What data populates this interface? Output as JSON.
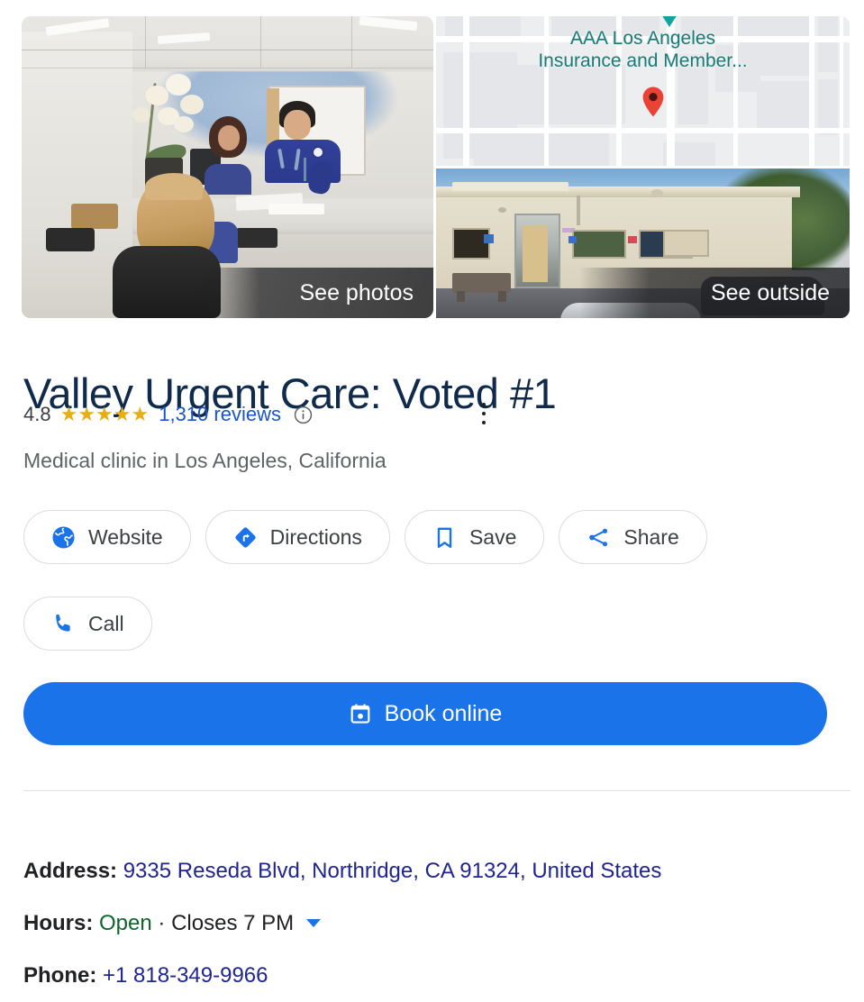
{
  "media": {
    "clinic_photo": {
      "name": "clinic-interior-photo",
      "overlay_label": "See photos"
    },
    "map": {
      "name": "location-map",
      "poi_label_line1": "AAA Los Angeles",
      "poi_label_line2": "Insurance and Member...",
      "pin": "map-pin"
    },
    "street_view": {
      "name": "street-view-photo",
      "overlay_label": "See outside"
    }
  },
  "business": {
    "title": "Valley Urgent Care: Voted #1",
    "rating_value": "4.8",
    "stars": "★★★★★",
    "stars_filled": 5,
    "reviews_label": "1,310 reviews",
    "reviews_count": 1310,
    "info_icon": "info-icon",
    "more_options_icon": "three-dot-menu-icon",
    "subtitle": "Medical clinic in Los Angeles, California"
  },
  "actions": [
    {
      "label": "Website",
      "icon": "globe-icon"
    },
    {
      "label": "Directions",
      "icon": "directions-diamond-icon"
    },
    {
      "label": "Save",
      "icon": "bookmark-icon"
    },
    {
      "label": "Share",
      "icon": "share-icon"
    },
    {
      "label": "Call",
      "icon": "phone-icon"
    }
  ],
  "primary_action": {
    "label": "Book online",
    "icon": "calendar-icon"
  },
  "details": {
    "address_key": "Address:",
    "address_value": "9335 Reseda Blvd, Northridge, CA 91324, United States",
    "hours_key": "Hours:",
    "hours_status": "Open",
    "hours_separator": "·",
    "hours_closes": "Closes 7 PM",
    "phone_key": "Phone:",
    "phone_value": "+1 818-349-9966"
  },
  "colors": {
    "accent_blue": "#1a73e8",
    "link_blue": "#1a56c4",
    "detail_link": "#20268e",
    "star_gold": "#e7b010",
    "open_green": "#0d652d",
    "title_navy": "#0f2a4a",
    "map_label_teal": "#1a7b76"
  }
}
